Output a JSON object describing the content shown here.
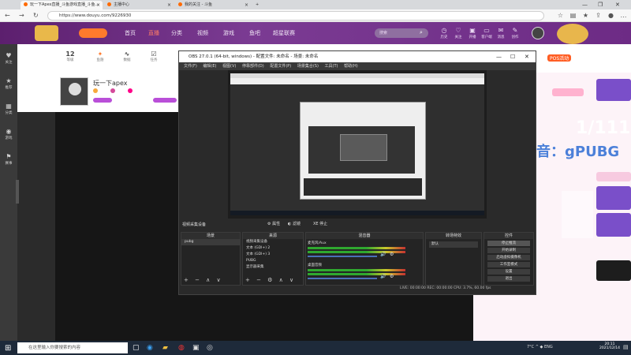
{
  "browser": {
    "tabs": [
      {
        "label": "玩一下Apex直播_斗鱼游戏直播_斗鱼..."
      },
      {
        "label": "主播中心"
      },
      {
        "label": "我的关注 - 斗鱼"
      }
    ],
    "url": "https://www.douyu.com/9226930"
  },
  "douyu": {
    "nav": [
      "首页",
      "直播",
      "分类",
      "视频",
      "游戏",
      "鱼吧",
      "超星联赛"
    ],
    "search_placeholder": "搜索",
    "header_icons": [
      "历史",
      "关注",
      "开播",
      "客户端",
      "消息",
      "创作"
    ],
    "left_items": [
      "关注",
      "推荐",
      "分类",
      "游戏",
      "赛事"
    ],
    "top_stats": [
      {
        "n": "12",
        "label": "等级"
      },
      {
        "n": "",
        "label": "鱼翅"
      },
      {
        "n": "",
        "label": "数据"
      },
      {
        "n": "",
        "label": "任务"
      }
    ],
    "anchor_name": "玩一下apex",
    "pos_label": "POS活动",
    "overlay_text": "1/111",
    "overlay_text2": "抖音：gPUBG"
  },
  "obs": {
    "title": "OBS 27.0.1 (64-bit, windows) - 配置文件: 未命名 - 场景: 未命名",
    "menu": [
      "文件(F)",
      "编辑(E)",
      "视图(V)",
      "停靠部件(D)",
      "配置文件(P)",
      "场景集合(S)",
      "工具(T)",
      "帮助(H)"
    ],
    "scene_label": "视频采集设备",
    "prop_btn": "属性",
    "filter_btn": "滤镜",
    "mode_btn": "XE 停止",
    "docks": {
      "scenes": {
        "header": "场景",
        "items": [
          "pubg"
        ]
      },
      "sources": {
        "header": "来源",
        "items": [
          "视频采集设备",
          "文本 (GDI+) 2",
          "文本 (GDI+) 3",
          "PUBG",
          "显示器采集"
        ]
      },
      "mixer": {
        "header": "混音器",
        "tracks": [
          "麦克风/Aux",
          "桌面音频"
        ]
      },
      "transitions": {
        "header": "转场特效",
        "value": "默认"
      },
      "controls": {
        "header": "控件",
        "buttons": [
          "停止推流",
          "开始录制",
          "启动虚拟摄像机",
          "工作室模式",
          "设置",
          "退出"
        ]
      }
    },
    "status": "LIVE: 00:00:00   REC: 00:00:00   CPU: 3.7%, 60.00 fps"
  },
  "taskbar": {
    "search_placeholder": "在这里输入你要搜索的内容",
    "tray": "7°C  ^  ◆  ENG",
    "time": "20:11",
    "date": "2021/12/14"
  }
}
